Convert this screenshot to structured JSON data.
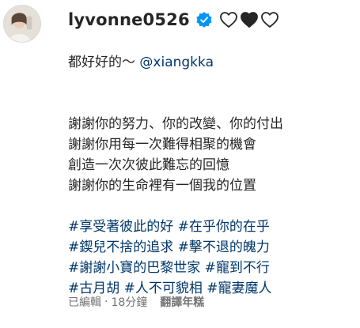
{
  "post": {
    "username": "lyvonne0526",
    "verified": true,
    "header_emojis": [
      "white-heart",
      "black-heart",
      "white-heart"
    ]
  },
  "caption": {
    "first_line_text": "都好好的～ ",
    "mention": "@xiangkka",
    "paragraph": [
      "謝謝你的努力、你的改變、你的付出",
      "謝謝你用每一次難得相聚的機會",
      "創造一次次彼此難忘的回憶",
      "謝謝你的生命裡有一個我的位置"
    ],
    "hashtag_lines": [
      "#享受著彼此的好 #在乎你的在乎",
      "#鍥兒不捨的追求 #擊不退的魄力",
      "#謝謝小寶的巴黎世家 #寵到不行",
      "#古月胡 #人不可貌相 #寵妻魔人"
    ]
  },
  "meta": {
    "edited": "已編輯",
    "separator": "·",
    "time": "18分鐘",
    "translate_label": "翻譯年糕"
  },
  "colors": {
    "text": "#262626",
    "link": "#00376b",
    "meta": "#737373",
    "verified": "#0095f6"
  }
}
